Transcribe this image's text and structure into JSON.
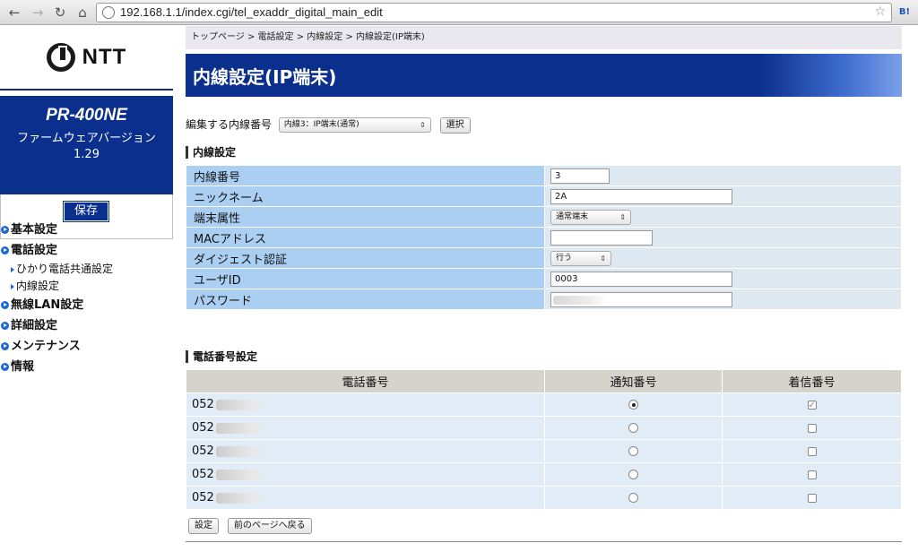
{
  "browser": {
    "url": "192.168.1.1/index.cgi/tel_exaddr_digital_main_edit",
    "bookmark_label": "B!"
  },
  "sidebar": {
    "logo_text": "NTT",
    "model_name": "PR-400NE",
    "fw_label": "ファームウェアバージョン",
    "fw_version": "1.29",
    "save_label": "保存",
    "menu": [
      {
        "label": "基本設定"
      },
      {
        "label": "電話設定"
      },
      {
        "label": "無線LAN設定"
      },
      {
        "label": "詳細設定"
      },
      {
        "label": "メンテナンス"
      },
      {
        "label": "情報"
      }
    ],
    "submenu": [
      {
        "label": "ひかり電話共通設定"
      },
      {
        "label": "内線設定"
      }
    ]
  },
  "main": {
    "breadcrumb": "トップページ > 電話設定 > 内線設定 > 内線設定(IP端末)",
    "title": "内線設定(IP端末)",
    "selector_label": "編集する内線番号",
    "selector_value": "内線3：IP端末(通常)",
    "select_button": "選択",
    "extension_section": "内線設定",
    "fields": {
      "ext_number": {
        "label": "内線番号",
        "value": "3"
      },
      "nickname": {
        "label": "ニックネーム",
        "value": "2A"
      },
      "terminal_attr": {
        "label": "端末属性",
        "value": "通常端末"
      },
      "mac": {
        "label": "MACアドレス",
        "value": ""
      },
      "digest": {
        "label": "ダイジェスト認証",
        "value": "行う"
      },
      "user_id": {
        "label": "ユーザID",
        "value": "0003"
      },
      "password": {
        "label": "パスワード",
        "value": ""
      }
    },
    "phone_section": "電話番号設定",
    "phone_headers": {
      "number": "電話番号",
      "notify": "通知番号",
      "incoming": "着信番号"
    },
    "phone_rows": [
      {
        "prefix": "052",
        "notify": true,
        "incoming": true
      },
      {
        "prefix": "052",
        "notify": false,
        "incoming": false
      },
      {
        "prefix": "052",
        "notify": false,
        "incoming": false
      },
      {
        "prefix": "052",
        "notify": false,
        "incoming": false
      },
      {
        "prefix": "052",
        "notify": false,
        "incoming": false
      }
    ],
    "set_button": "設定",
    "back_button": "前のページへ戻る"
  }
}
